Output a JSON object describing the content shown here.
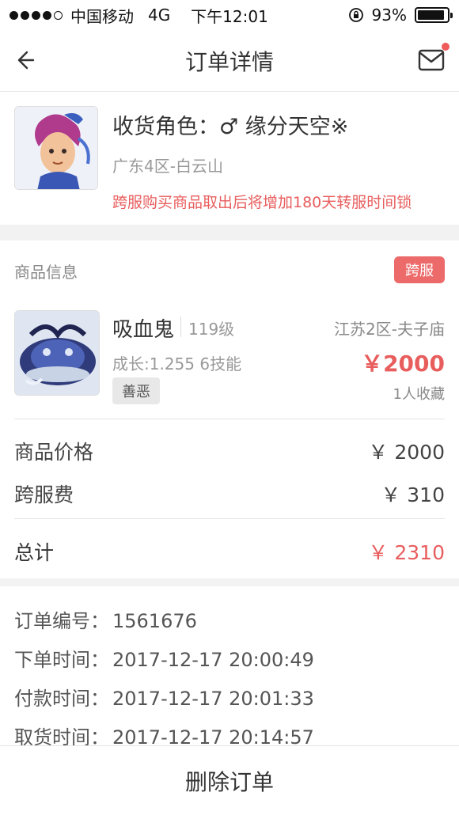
{
  "status_bar": {
    "carrier": "中国移动",
    "network": "4G",
    "time": "下午12:01",
    "battery": "93%",
    "battery_level": 0.93
  },
  "nav": {
    "title": "订单详情"
  },
  "receiver": {
    "role_line": "收货角色：♂ 缘分天空※",
    "server": "广东4区-白云山",
    "warning": "跨服购买商品取出后将增加180天转服时间锁"
  },
  "product": {
    "section_label": "商品信息",
    "badge": "跨服",
    "name": "吸血鬼",
    "level": "119级",
    "server": "江苏2区-夫子庙",
    "stats": "成长:1.255 6技能",
    "price": "￥2000",
    "tag": "善恶",
    "favorites": "1人收藏"
  },
  "fees": {
    "item_price_label": "商品价格",
    "item_price_value": "￥ 2000",
    "cross_fee_label": "跨服费",
    "cross_fee_value": "￥ 310",
    "total_label": "总计",
    "total_value": "￥ 2310"
  },
  "order": {
    "number_label": "订单编号：",
    "number_value": "1561676",
    "created_label": "下单时间：",
    "created_value": "2017-12-17 20:00:49",
    "paid_label": "付款时间：",
    "paid_value": "2017-12-17 20:01:33",
    "picked_label": "取货时间：",
    "picked_value": "2017-12-17 20:14:57"
  },
  "bottom": {
    "delete_label": "删除订单"
  },
  "colors": {
    "accent_red": "#e85d5d",
    "badge_red": "#ec6a6a"
  }
}
